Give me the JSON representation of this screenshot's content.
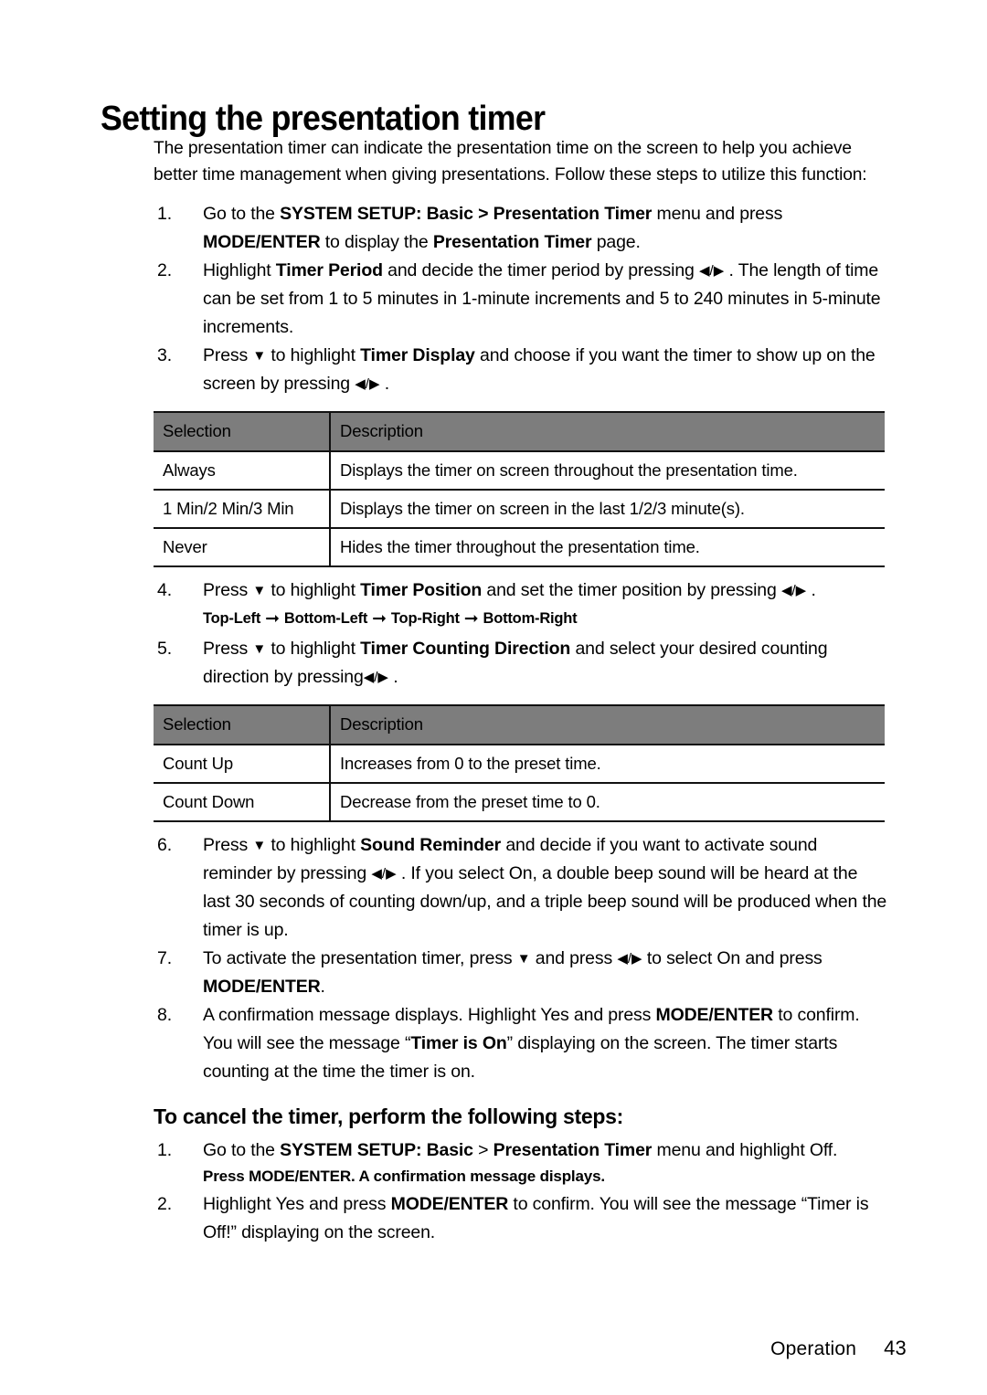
{
  "document": {
    "title": "Setting the presentation timer",
    "intro": "The presentation timer can indicate the presentation time on the screen to help you achieve better time management when giving presentations. Follow these steps to utilize this function:",
    "footer": {
      "section": "Operation",
      "page_number": "43"
    }
  },
  "icons": {
    "left_triangle": "◀",
    "right_triangle": "▶",
    "down_triangle": "▼",
    "slash": "/",
    "right_arrow": "➞"
  },
  "steps": [
    {
      "num": "1.",
      "parts": [
        {
          "t": "Go to the ",
          "b": false
        },
        {
          "t": "SYSTEM SETUP: Basic > Presentation Timer",
          "b": true
        },
        {
          "t": " menu and press ",
          "b": false
        },
        {
          "t": "MODE/ENTER",
          "b": true
        },
        {
          "t": " to display the ",
          "b": false
        },
        {
          "t": "Presentation Timer",
          "b": true
        },
        {
          "t": " page.",
          "b": false
        }
      ]
    },
    {
      "num": "2.",
      "parts": [
        {
          "t": "Highlight ",
          "b": false
        },
        {
          "t": "Timer Period",
          "b": true
        },
        {
          "t": " and decide the timer period by pressing ",
          "b": false
        },
        {
          "t": "@LR",
          "b": false
        },
        {
          "t": " . The length of time can be set from 1 to 5 minutes in 1-minute increments and 5 to 240 minutes in 5-minute increments.",
          "b": false
        }
      ]
    },
    {
      "num": "3.",
      "parts": [
        {
          "t": "Press ",
          "b": false
        },
        {
          "t": "@DN",
          "b": false
        },
        {
          "t": " to highlight ",
          "b": false
        },
        {
          "t": "Timer Display",
          "b": true
        },
        {
          "t": " and choose if you want the timer to show up on the screen by pressing ",
          "b": false
        },
        {
          "t": "@LR",
          "b": false
        },
        {
          "t": " .",
          "b": false
        }
      ]
    }
  ],
  "table_display": {
    "headers": [
      "Selection",
      "Description"
    ],
    "rows": [
      [
        "Always",
        "Displays the timer on screen throughout the presentation time."
      ],
      [
        "1 Min/2 Min/3 Min",
        "Displays the timer on screen in the last 1/2/3 minute(s)."
      ],
      [
        "Never",
        "Hides the timer throughout the presentation time."
      ]
    ]
  },
  "steps_2": [
    {
      "num": "4.",
      "parts": [
        {
          "t": "Press ",
          "b": false
        },
        {
          "t": "@DN",
          "b": false
        },
        {
          "t": " to highlight ",
          "b": false
        },
        {
          "t": "Timer Position",
          "b": true
        },
        {
          "t": " and set the timer position by pressing ",
          "b": false
        },
        {
          "t": "@LR",
          "b": false
        },
        {
          "t": " .",
          "b": false
        }
      ]
    }
  ],
  "position_sequence": [
    "Top-Left",
    "Bottom-Left",
    "Top-Right",
    "Bottom-Right"
  ],
  "steps_3": [
    {
      "num": "5.",
      "parts": [
        {
          "t": "Press ",
          "b": false
        },
        {
          "t": "@DN",
          "b": false
        },
        {
          "t": " to highlight ",
          "b": false
        },
        {
          "t": "Timer Counting Direction",
          "b": true
        },
        {
          "t": " and select your desired counting direction by pressing",
          "b": false
        },
        {
          "t": "@LR",
          "b": false
        },
        {
          "t": " .",
          "b": false
        }
      ]
    }
  ],
  "table_direction": {
    "headers": [
      "Selection",
      "Description"
    ],
    "rows": [
      [
        "Count Up",
        "Increases from 0 to the preset time."
      ],
      [
        "Count Down",
        "Decrease from the preset time to 0."
      ]
    ]
  },
  "steps_4": [
    {
      "num": "6.",
      "parts": [
        {
          "t": "Press ",
          "b": false
        },
        {
          "t": "@DN",
          "b": false
        },
        {
          "t": " to highlight ",
          "b": false
        },
        {
          "t": "Sound Reminder",
          "b": true
        },
        {
          "t": " and decide if you want to activate sound reminder by pressing ",
          "b": false
        },
        {
          "t": "@LR",
          "b": false
        },
        {
          "t": " . If you select On, a double beep sound will be heard at the last 30 seconds of counting down/up, and a triple beep sound will be produced when the timer is up.",
          "b": false
        }
      ]
    },
    {
      "num": "7.",
      "parts": [
        {
          "t": "To activate the presentation timer, press ",
          "b": false
        },
        {
          "t": "@DN",
          "b": false
        },
        {
          "t": " and press ",
          "b": false
        },
        {
          "t": "@LR",
          "b": false
        },
        {
          "t": " to select On and press ",
          "b": false
        },
        {
          "t": "MODE/ENTER",
          "b": true
        },
        {
          "t": ".",
          "b": false
        }
      ]
    },
    {
      "num": "8.",
      "parts": [
        {
          "t": "A confirmation message displays. Highlight Yes and press ",
          "b": false
        },
        {
          "t": "MODE/ENTER",
          "b": true
        },
        {
          "t": " to confirm. You will see the message “",
          "b": false
        },
        {
          "t": "Timer is On",
          "b": true
        },
        {
          "t": "” displaying on the  screen. The timer starts counting at the time the timer is on.",
          "b": false
        }
      ]
    }
  ],
  "cancel_section": {
    "heading": "To cancel the timer, perform the following steps:",
    "note": "Press MODE/ENTER. A confirmation message displays.",
    "steps": [
      {
        "num": "1.",
        "parts": [
          {
            "t": "Go to the ",
            "b": false
          },
          {
            "t": "SYSTEM SETUP: Basic",
            "b": true
          },
          {
            "t": " > ",
            "b": false
          },
          {
            "t": "Presentation Timer",
            "b": true
          },
          {
            "t": " menu and highlight Off.",
            "b": false
          }
        ]
      },
      {
        "num": "2.",
        "parts": [
          {
            "t": "Highlight Yes and press ",
            "b": false
          },
          {
            "t": "MODE/ENTER",
            "b": true
          },
          {
            "t": " to confirm. You will see the message “Timer is Off!” displaying on the screen.",
            "b": false
          }
        ]
      }
    ]
  },
  "colors": {
    "table_header_bg": "#7d7d7d",
    "rule": "#111111",
    "text": "#000000"
  }
}
